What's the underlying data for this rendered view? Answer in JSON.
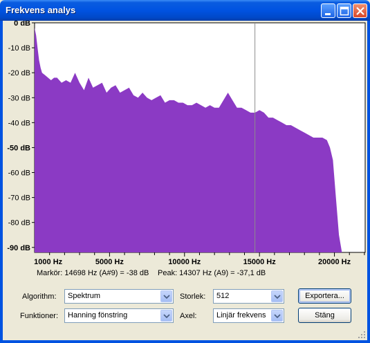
{
  "window": {
    "title": "Frekvens analys"
  },
  "chart_data": {
    "type": "area",
    "y_ticks": [
      "0 dB",
      "-10 dB",
      "-20 dB",
      "-30 dB",
      "-40 dB",
      "-50 dB",
      "-60 dB",
      "-70 dB",
      "-80 dB",
      "-90 dB"
    ],
    "y_ticks_bold": [
      "0 dB",
      "-50 dB",
      "-90 dB"
    ],
    "x_ticks": [
      "1000 Hz",
      "5000 Hz",
      "10000 Hz",
      "15000 Hz",
      "20000 Hz"
    ],
    "ylim": [
      -92,
      0
    ],
    "xlim": [
      0,
      22050
    ],
    "cursor_hz": 14698,
    "fill_color": "#8b3ac4",
    "series": [
      {
        "x": [
          0,
          100,
          200,
          300,
          400,
          500,
          700,
          900,
          1100,
          1300,
          1500,
          1800,
          2100,
          2400,
          2700,
          3000,
          3300,
          3600,
          3900,
          4200,
          4500,
          4800,
          5100,
          5400,
          5700,
          6000,
          6300,
          6600,
          6900,
          7200,
          7500,
          7800,
          8100,
          8400,
          8700,
          9000,
          9300,
          9600,
          9900,
          10200,
          10500,
          10800,
          11100,
          11400,
          11700,
          12000,
          12300,
          12600,
          12900,
          13200,
          13500,
          13800,
          14100,
          14400,
          14700,
          15000,
          15300,
          15600,
          15900,
          16200,
          16500,
          16800,
          17100,
          17400,
          17700,
          18000,
          18300,
          18600,
          18900,
          19200,
          19500,
          19700,
          19900,
          20100,
          20300,
          20500
        ],
        "values": [
          -2,
          -5,
          -10,
          -15,
          -18,
          -20,
          -21,
          -22,
          -23,
          -22,
          -22,
          -24,
          -23,
          -24,
          -20,
          -24,
          -27,
          -22,
          -26,
          -25,
          -24,
          -28,
          -26,
          -25,
          -28,
          -27,
          -26,
          -29,
          -30,
          -28,
          -30,
          -31,
          -30,
          -29,
          -32,
          -31,
          -31,
          -32,
          -32,
          -33,
          -33,
          -32,
          -33,
          -34,
          -33,
          -34,
          -34,
          -31,
          -28,
          -31,
          -34,
          -34,
          -35,
          -36,
          -36,
          -35,
          -36,
          -38,
          -38,
          -39,
          -40,
          -41,
          -41,
          -42,
          -43,
          -44,
          -45,
          -46,
          -46,
          -46,
          -47,
          -50,
          -55,
          -70,
          -85,
          -92
        ]
      }
    ]
  },
  "info": {
    "marker": "Markör: 14698 Hz (A#9) = -38 dB",
    "peak": "Peak: 14307 Hz (A9) = -37,1 dB"
  },
  "controls": {
    "algorithm_label": "Algorithm:",
    "algorithm_value": "Spektrum",
    "functions_label": "Funktioner:",
    "functions_value": "Hanning fönstring",
    "size_label": "Storlek:",
    "size_value": "512",
    "axis_label": "Axel:",
    "axis_value": "Linjär frekvens",
    "export_label": "Exportera...",
    "close_label": "Stäng"
  }
}
